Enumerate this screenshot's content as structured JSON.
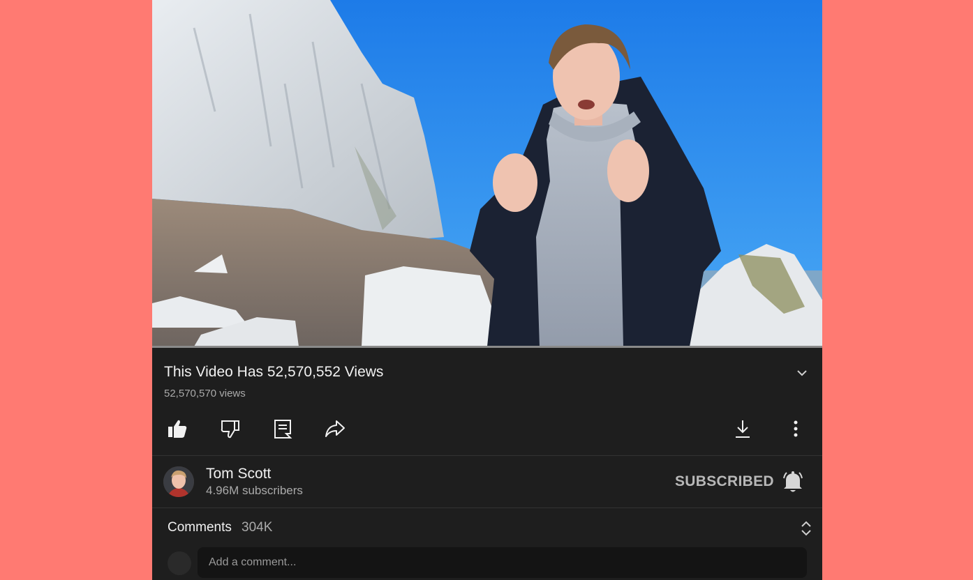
{
  "video": {
    "title": "This Video Has 52,570,552 Views",
    "views": "52,570,570 views",
    "progress": 0.0
  },
  "actions": {
    "like": "like-icon",
    "dislike": "dislike-icon",
    "comments": "comment-icon",
    "share": "share-icon",
    "download": "download-icon",
    "more": "more-vertical-icon"
  },
  "channel": {
    "name": "Tom Scott",
    "subscribers": "4.96M subscribers",
    "subscribe_label": "SUBSCRIBED"
  },
  "comments": {
    "label": "Comments",
    "count": "304K",
    "placeholder": "Add a comment..."
  },
  "colors": {
    "page_background": "#ff7a72",
    "app_background": "#1e1e1e",
    "text_primary": "#f1f1f1",
    "text_secondary": "#aaaaaa"
  }
}
